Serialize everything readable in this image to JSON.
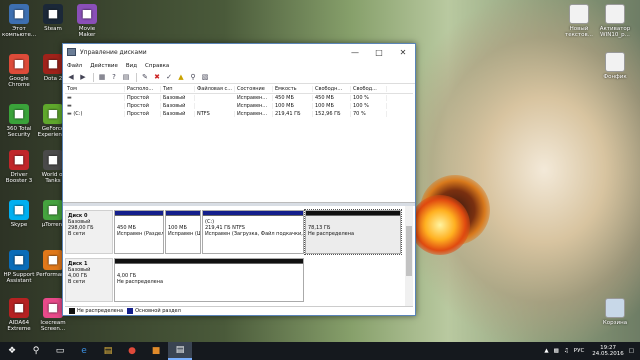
{
  "desktop": {
    "left_icons": [
      {
        "label": "Этот компьюте...",
        "icon": "computer-icon",
        "color": "#3d6fb0"
      },
      {
        "label": "Steam",
        "icon": "steam-icon",
        "color": "#1b2838"
      },
      {
        "label": "Movie Maker",
        "icon": "movie-maker-icon",
        "color": "#8a4fb8"
      },
      {
        "label": "Google Chrome",
        "icon": "chrome-icon",
        "color": "#dd4b39"
      },
      {
        "label": "Dota 2",
        "icon": "dota-icon",
        "color": "#a0221a"
      },
      {
        "label": "360 Total Security",
        "icon": "security-icon",
        "color": "#3aa33a"
      },
      {
        "label": "GeForce Experience",
        "icon": "geforce-icon",
        "color": "#5fa82c"
      },
      {
        "label": "Driver Booster 3",
        "icon": "driver-booster-icon",
        "color": "#c0262a"
      },
      {
        "label": "World of Tanks",
        "icon": "tanks-icon",
        "color": "#4a4a4a"
      },
      {
        "label": "Skype",
        "icon": "skype-icon",
        "color": "#00aff0"
      },
      {
        "label": "µTorrent",
        "icon": "utorrent-icon",
        "color": "#45a33f"
      },
      {
        "label": "HP Support Assistant",
        "icon": "hp-icon",
        "color": "#0a6cb8"
      },
      {
        "label": "Performan...",
        "icon": "performance-icon",
        "color": "#e0781a"
      },
      {
        "label": "AIDA64 Extreme",
        "icon": "aida-icon",
        "color": "#b52222"
      },
      {
        "label": "Icecream Screen...",
        "icon": "icecream-icon",
        "color": "#e84a8a"
      }
    ],
    "right_icons": [
      {
        "label": "Новый текстов...",
        "icon": "text-file-icon",
        "color": "#f2f2f2"
      },
      {
        "label": "Активатор WIN10_p...",
        "icon": "file-icon",
        "color": "#f2f2f2"
      },
      {
        "label": "Фонфик",
        "icon": "file-icon",
        "color": "#f2f2f2"
      },
      {
        "label": "Корзина",
        "icon": "recycle-bin-icon",
        "color": "#c8d8e8"
      }
    ]
  },
  "window": {
    "title": "Управление дисками",
    "menu": [
      "Файл",
      "Действие",
      "Вид",
      "Справка"
    ]
  },
  "volumes": {
    "headers": [
      "Том",
      "Располо...",
      "Тип",
      "Файловая с...",
      "Состояние",
      "Емкость",
      "Свободн...",
      "Свобод..."
    ],
    "rows": [
      [
        "",
        "Простой",
        "Базовый",
        "",
        "Исправен...",
        "450 МБ",
        "450 МБ",
        "100 %"
      ],
      [
        "",
        "Простой",
        "Базовый",
        "",
        "Исправен...",
        "100 МБ",
        "100 МБ",
        "100 %"
      ],
      [
        "(C:)",
        "Простой",
        "Базовый",
        "NTFS",
        "Исправен...",
        "219,41 ГБ",
        "152,96 ГБ",
        "70 %"
      ]
    ]
  },
  "disks": [
    {
      "name": "Диск 0",
      "type": "Базовый",
      "size": "298,00 ГБ",
      "status": "В сети",
      "partitions": [
        {
          "line1": "",
          "line2": "450 МБ",
          "line3": "Исправен (Раздел",
          "bar": "#141f8c",
          "fraction": 0.0015
        },
        {
          "line1": "",
          "line2": "100 МБ",
          "line3": "Исправен (Ш",
          "bar": "#141f8c",
          "fraction": 0.0003
        },
        {
          "line1": "(C:)",
          "line2": "219,41 ГБ NTFS",
          "line3": "Исправен (Загрузка, Файл подкачки, А",
          "bar": "#141f8c",
          "fraction": 0.736
        },
        {
          "line1": "",
          "line2": "78,13 ГБ",
          "line3": "Не распределена",
          "bar": "#111111",
          "fraction": 0.262
        }
      ]
    },
    {
      "name": "Диск 1",
      "type": "Базовый",
      "size": "4,00 ГБ",
      "status": "В сети",
      "partitions": [
        {
          "line1": "",
          "line2": "4,00 ГБ",
          "line3": "Не распределена",
          "bar": "#111111",
          "fraction": 1
        }
      ]
    }
  ],
  "legend": [
    {
      "label": "Не распределена",
      "color": "#111111"
    },
    {
      "label": "Основной раздел",
      "color": "#141f8c"
    }
  ],
  "taskbar": {
    "lang": "РУС",
    "time": "19:27",
    "date": "24.05.2016"
  }
}
